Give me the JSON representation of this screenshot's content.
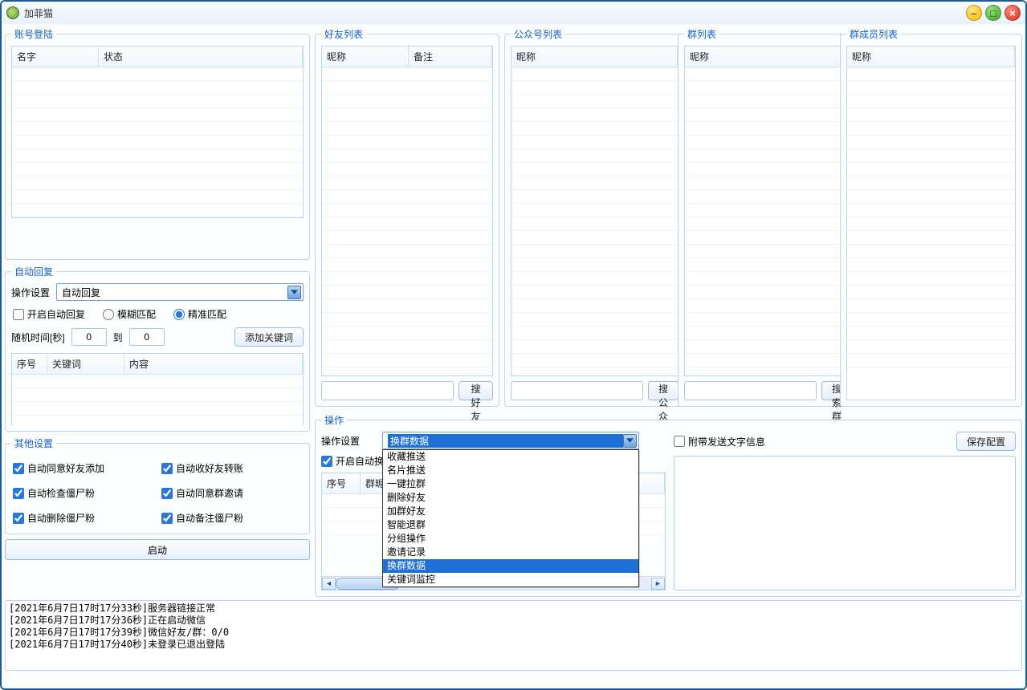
{
  "window": {
    "title": "加菲猫"
  },
  "win_buttons": {
    "min": "–",
    "max": "□",
    "close": "×"
  },
  "groups": {
    "account_login": "账号登陆",
    "auto_reply": "自动回复",
    "other_settings": "其他设置",
    "friend_list": "好友列表",
    "gzh_list": "公众号列表",
    "group_list": "群列表",
    "member_list": "群成员列表",
    "operation": "操作"
  },
  "account_table": {
    "col1": "名字",
    "col2": "状态"
  },
  "friends_table": {
    "col1": "昵称",
    "col2": "备注"
  },
  "gzh_table": {
    "col1": "昵称"
  },
  "groups_table": {
    "col1": "昵称"
  },
  "members_table": {
    "col1": "昵称"
  },
  "search": {
    "friends_btn": "搜好友",
    "gzh_btn": "搜公众号",
    "groups_btn": "搜索群"
  },
  "auto_reply": {
    "label": "操作设置",
    "select_value": "自动回复",
    "enable": "开启自动回复",
    "fuzzy": "模糊匹配",
    "exact": "精准匹配",
    "rand_label": "随机时间[秒]",
    "to": "到",
    "val1": "0",
    "val2": "0",
    "add_kw": "添加关键词",
    "kw_col1": "序号",
    "kw_col2": "关键词",
    "kw_col3": "内容"
  },
  "other": {
    "c1": "自动同意好友添加",
    "c2": "自动收好友转账",
    "c3": "自动检查僵尸粉",
    "c4": "自动同意群邀请",
    "c5": "自动删除僵尸粉",
    "c6": "自动备注僵尸粉"
  },
  "start_btn": "启动",
  "ops": {
    "label": "操作设置",
    "select_value": "换群数据",
    "options": [
      "收藏推送",
      "名片推送",
      "一键拉群",
      "删除好友",
      "加群好友",
      "智能退群",
      "分组操作",
      "邀请记录",
      "换群数据",
      "关键词监控"
    ],
    "enable_checkbox": "开启自动换群",
    "attach_text": "附带发送文字信息",
    "save_btn": "保存配置",
    "group_tbl_col1": "序号",
    "group_tbl_col2": "群昵称"
  },
  "log_lines": [
    "[2021年6月7日17时17分33秒]服务器链接正常",
    "[2021年6月7日17时17分36秒]正在启动微信",
    "[2021年6月7日17时17分39秒]微信好友/群：0/0",
    "[2021年6月7日17时17分40秒]未登录已退出登陆"
  ]
}
